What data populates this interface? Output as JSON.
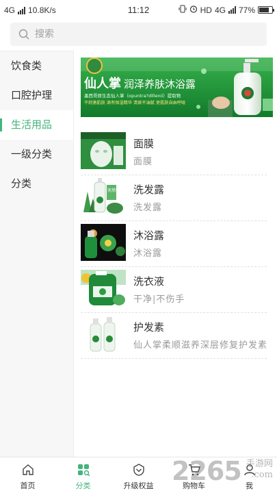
{
  "status_bar": {
    "network": "4G",
    "speed": "10.8K/s",
    "time": "11:12",
    "hd": "HD",
    "net_right": "4G",
    "battery": "77%",
    "battery_level": 0.77
  },
  "search": {
    "placeholder": "搜索"
  },
  "sidebar": {
    "items": [
      {
        "label": "饮食类"
      },
      {
        "label": "口腔护理"
      },
      {
        "label": "生活用品",
        "active": true
      },
      {
        "label": "一级分类"
      },
      {
        "label": "分类"
      }
    ]
  },
  "banner": {
    "title": "仙人掌",
    "subtitle": "润泽养肤沐浴露",
    "line1": "墨西哥原生态仙人掌（opuntra?dillenii）提取物",
    "line2": "不刺激肌肤  滴有保湿精华  清爽不油腻  使肌肤自由呼吸"
  },
  "products": [
    {
      "name": "面膜",
      "desc": "面膜"
    },
    {
      "name": "洗发露",
      "desc": "洗发露",
      "badge": "天然植物"
    },
    {
      "name": "沐浴露",
      "desc": "沐浴露"
    },
    {
      "name": "洗衣液",
      "desc": "干净|不伤手"
    },
    {
      "name": "护发素",
      "desc": "仙人掌柔顺滋养深层修复护发素"
    }
  ],
  "bottom_nav": [
    {
      "label": "首页",
      "icon": "home-icon"
    },
    {
      "label": "分类",
      "icon": "category-icon",
      "active": true
    },
    {
      "label": "升级权益",
      "icon": "upgrade-icon"
    },
    {
      "label": "购物车",
      "icon": "cart-icon"
    },
    {
      "label": "我",
      "icon": "user-icon"
    }
  ],
  "watermark": {
    "brand": "2265",
    "suffix": ".com",
    "site": "手游网"
  },
  "colors": {
    "accent": "#43b57c",
    "banner_green": "#1f9a3a"
  }
}
